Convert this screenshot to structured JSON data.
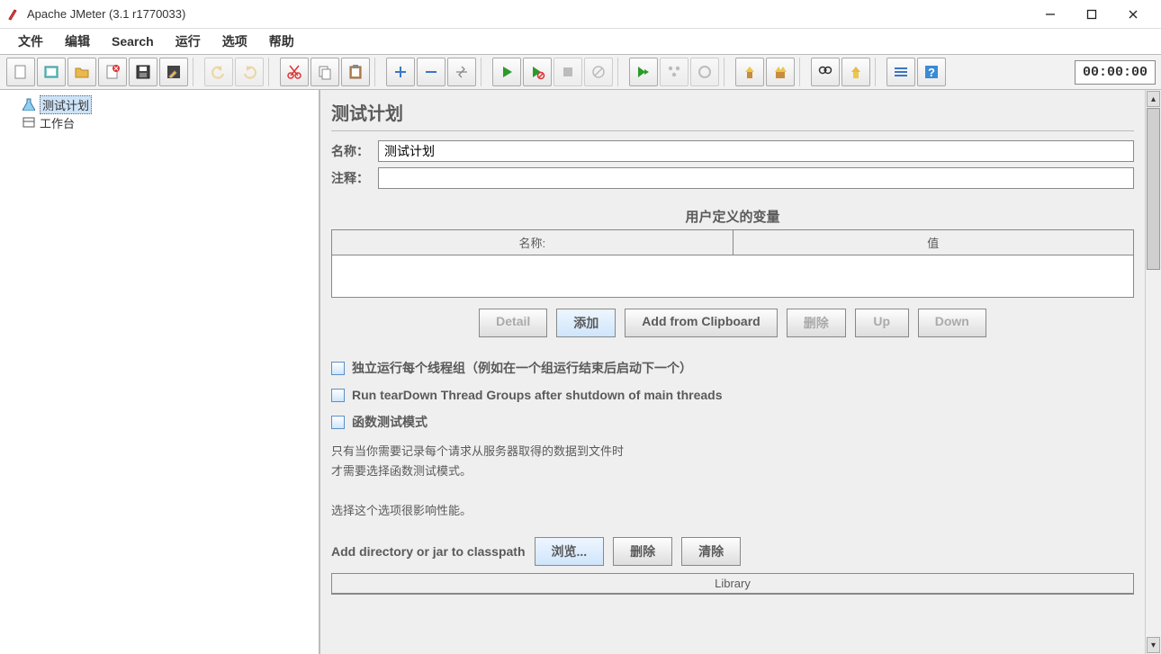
{
  "window": {
    "title": "Apache JMeter (3.1 r1770033)"
  },
  "menu": {
    "file": "文件",
    "edit": "编辑",
    "search": "Search",
    "run": "运行",
    "options": "选项",
    "help": "帮助"
  },
  "toolbar": {
    "timer": "00:00:00"
  },
  "tree": {
    "items": [
      {
        "label": "测试计划",
        "selected": true
      },
      {
        "label": "工作台",
        "selected": false
      }
    ]
  },
  "panel": {
    "title": "测试计划",
    "name_label": "名称：",
    "name_value": "测试计划",
    "comment_label": "注释：",
    "comment_value": "",
    "vars_title": "用户定义的变量",
    "vars_cols": {
      "name": "名称:",
      "value": "值"
    },
    "buttons": {
      "detail": "Detail",
      "add": "添加",
      "add_clip": "Add from Clipboard",
      "delete": "删除",
      "up": "Up",
      "down": "Down"
    },
    "chk1": "独立运行每个线程组（例如在一个组运行结束后启动下一个）",
    "chk2": "Run tearDown Thread Groups after shutdown of main threads",
    "chk3": "函数测试模式",
    "help1": "只有当你需要记录每个请求从服务器取得的数据到文件时",
    "help2": "才需要选择函数测试模式。",
    "help3": "选择这个选项很影响性能。",
    "cp_label": "Add directory or jar to classpath",
    "cp_browse": "浏览...",
    "cp_delete": "删除",
    "cp_clear": "清除",
    "lib_header": "Library"
  }
}
